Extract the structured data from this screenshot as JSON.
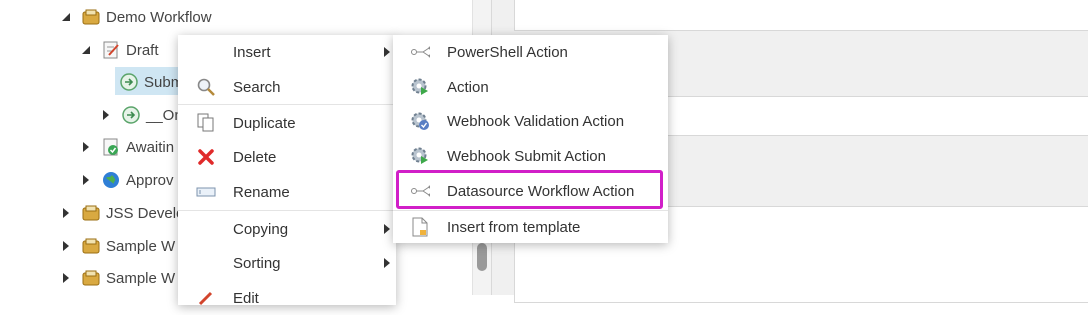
{
  "tree": {
    "nodes": [
      {
        "label": "Demo Workflow",
        "icon": "workflow-folder-icon"
      },
      {
        "label": "Draft",
        "icon": "draft-state-icon"
      },
      {
        "label": "Submi",
        "icon": "command-arrow-icon"
      },
      {
        "label": "__On",
        "icon": "command-arrow-icon"
      },
      {
        "label": "Awaitin",
        "icon": "awaiting-approval-icon"
      },
      {
        "label": "Approv",
        "icon": "globe-icon"
      },
      {
        "label": "JSS Develo",
        "icon": "workflow-folder-icon"
      },
      {
        "label": "Sample W",
        "icon": "workflow-folder-icon"
      },
      {
        "label": "Sample W",
        "icon": "workflow-folder-icon"
      }
    ]
  },
  "context_menu": {
    "items": [
      {
        "label": "Insert",
        "icon": "",
        "submenu": true
      },
      {
        "label": "Search",
        "icon": "search-icon"
      },
      {
        "label": "Duplicate",
        "icon": "duplicate-icon"
      },
      {
        "label": "Delete",
        "icon": "delete-icon"
      },
      {
        "label": "Rename",
        "icon": "rename-icon"
      },
      {
        "label": "Copying",
        "icon": "",
        "submenu": true
      },
      {
        "label": "Sorting",
        "icon": "",
        "submenu": true
      },
      {
        "label": "Edit",
        "icon": "edit-icon"
      }
    ]
  },
  "insert_submenu": {
    "items": [
      {
        "label": "PowerShell Action",
        "icon": "connector-icon"
      },
      {
        "label": "Action",
        "icon": "gear-play-icon"
      },
      {
        "label": "Webhook Validation Action",
        "icon": "gear-check-icon"
      },
      {
        "label": "Webhook Submit Action",
        "icon": "gear-play-icon"
      },
      {
        "label": "Datasource Workflow Action",
        "icon": "connector-icon"
      },
      {
        "label": "Insert from template",
        "icon": "template-icon"
      }
    ]
  },
  "colors": {
    "highlight_outline": "#d11fc8",
    "selected_row": "#cfe6f3",
    "delete_red": "#e02a2a"
  }
}
